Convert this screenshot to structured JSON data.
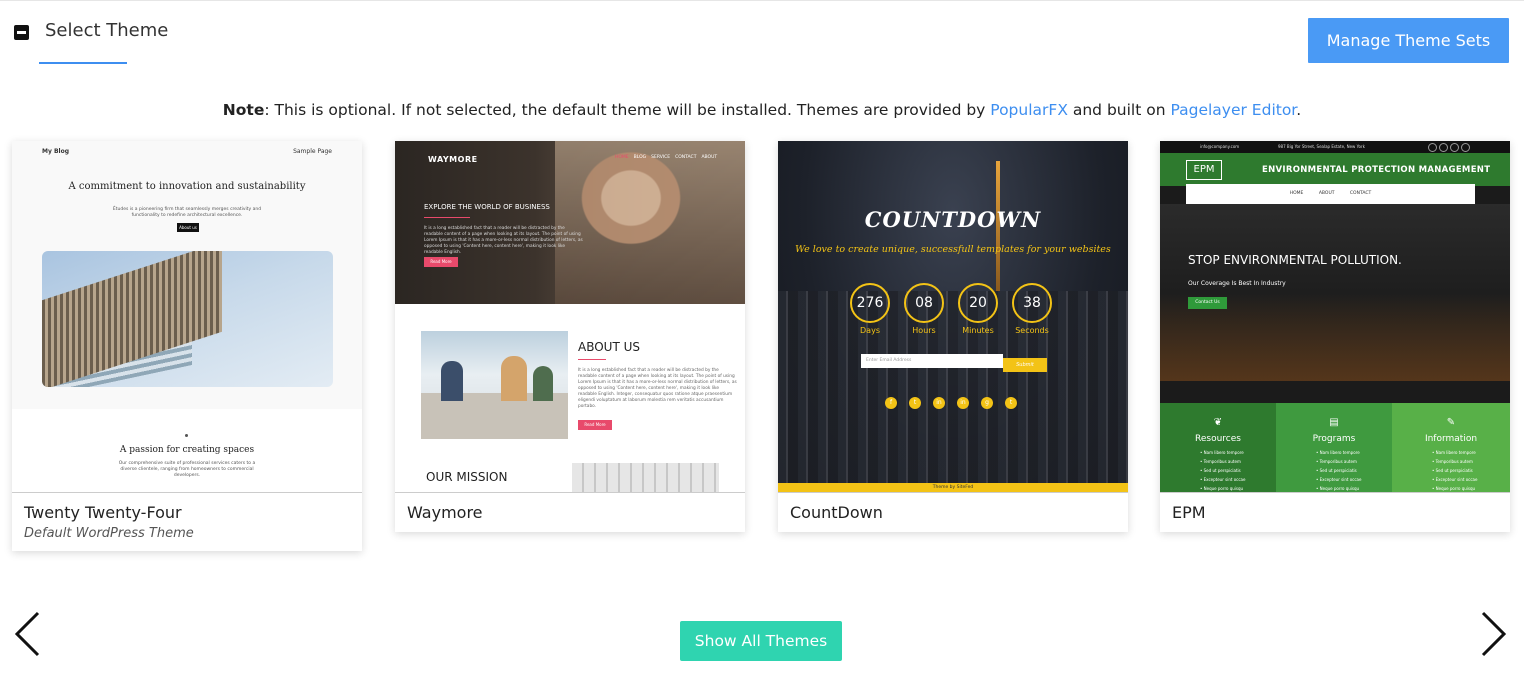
{
  "header": {
    "title": "Select Theme",
    "manage_label": "Manage Theme Sets"
  },
  "note": {
    "bold": "Note",
    "text1": ": This is optional. If not selected, the default theme will be installed. Themes are provided by ",
    "link1": "PopularFX",
    "text2": " and built on ",
    "link2": "Pagelayer Editor",
    "text3": "."
  },
  "themes": [
    {
      "name": "Twenty Twenty-Four",
      "subtitle": "Default WordPress Theme",
      "preview": {
        "site_title": "My Blog",
        "nav": "Sample Page",
        "headline": "A commitment to innovation and sustainability",
        "text": "Études is a pioneering firm that seamlessly merges creativity and functionality to redefine architectural excellence.",
        "button": "About us",
        "headline2": "A passion for creating spaces",
        "text2": "Our comprehensive suite of professional services caters to a diverse clientele, ranging from homeowners to commercial developers."
      }
    },
    {
      "name": "Waymore",
      "preview": {
        "logo": "WAYMORE",
        "nav": [
          "HOME",
          "BLOG",
          "SERVICE",
          "CONTACT",
          "ABOUT"
        ],
        "hero_title": "EXPLORE THE WORLD OF BUSINESS",
        "hero_text": "It is a long established fact that a reader will be distracted by the readable content of a page when looking at its layout. The point of using Lorem Ipsum is that it has a more-or-less normal distribution of letters, as opposed to using 'Content here, content here', making it look like readable English.",
        "hero_button": "Read More",
        "about_title": "ABOUT US",
        "about_text": "It is a long established fact that a reader will be distracted by the readable content of a page when looking at its layout. The point of using Lorem Ipsum is that it has a more-or-less normal distribution of letters, as opposed to using 'Content here, content here', making it look like readable English. Integer, consequatur quos ratione atque praesentium eligendi voluptatum at laborum molestia rem veritatis accusantium portabo.",
        "about_button": "Read More",
        "mission_title": "OUR MISSION"
      }
    },
    {
      "name": "CountDown",
      "preview": {
        "title": "COUNTDOWN",
        "tagline": "We love to create unique, successfull templates for your websites",
        "counters": [
          {
            "value": "276",
            "label": "Days"
          },
          {
            "value": "08",
            "label": "Hours"
          },
          {
            "value": "20",
            "label": "Minutes"
          },
          {
            "value": "38",
            "label": "Seconds"
          }
        ],
        "email_placeholder": "Enter Email Address",
        "submit": "Submit",
        "social": [
          "f",
          "t",
          "in",
          "in",
          "g",
          "t"
        ],
        "footer": "Theme by SiteFed"
      }
    },
    {
      "name": "EPM",
      "preview": {
        "topbar_left": "info@company.com",
        "topbar_mid": "987 Big Yor Street, Sealap Estate, New York",
        "logo": "EPM",
        "title": "ENVIRONMENTAL PROTECTION MANAGEMENT",
        "nav": "HOME ABOUT CONTACT",
        "hero_title": "STOP ENVIRONMENTAL POLLUTION.",
        "hero_sub": "Our Coverage Is Best In Industry",
        "hero_button": "Contact Us",
        "columns": [
          {
            "title": "Resources",
            "items": [
              "Nam libero tempore",
              "Temporibus autem",
              "Sed ut perspiciatis",
              "Excepteur sint occae",
              "Neque porro quisqu"
            ],
            "color": "#2e7a2e"
          },
          {
            "title": "Programs",
            "items": [
              "Nam libero tempore",
              "Temporibus autem",
              "Sed ut perspiciatis",
              "Excepteur sint occae",
              "Neque porro quisqu"
            ],
            "color": "#3f9a3f"
          },
          {
            "title": "Information",
            "items": [
              "Nam libero tempore",
              "Temporibus autem",
              "Sed ut perspiciatis",
              "Excepteur sint occae",
              "Neque porro quisqu"
            ],
            "color": "#58b048"
          }
        ]
      }
    }
  ],
  "actions": {
    "show_all": "Show All Themes",
    "prev_icon": "chevron-left-icon",
    "next_icon": "chevron-right-icon"
  },
  "colors": {
    "accent": "#4a9af5",
    "link": "#3d8ef0",
    "teal": "#2fd4b0"
  }
}
